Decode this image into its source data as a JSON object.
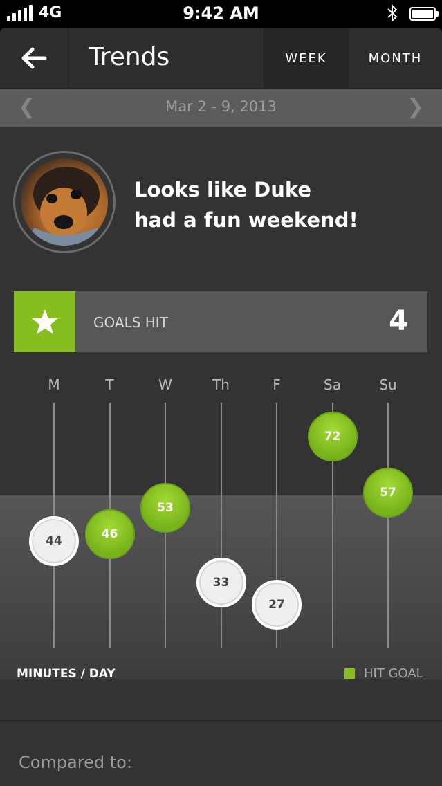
{
  "status_bar": {
    "carrier": "4G",
    "time": "9:42 AM"
  },
  "nav": {
    "title": "Trends",
    "tabs": [
      "WEEK",
      "MONTH"
    ],
    "selected_tab": "WEEK"
  },
  "date_range": {
    "label": "Mar 2 - 9, 2013",
    "prev": "❮",
    "next": "❯"
  },
  "message": {
    "line1": "Looks like Duke",
    "line2": "had a fun weekend!"
  },
  "goals": {
    "label": "GOALS HIT",
    "count": "4"
  },
  "colors": {
    "hit": "#86bd1f",
    "background": "#333334"
  },
  "chart_data": {
    "type": "scatter",
    "categories": [
      "M",
      "T",
      "W",
      "Th",
      "F",
      "Sa",
      "Su"
    ],
    "values": [
      44,
      46,
      53,
      33,
      27,
      72,
      57
    ],
    "hit_goal": [
      false,
      true,
      true,
      false,
      false,
      true,
      true
    ],
    "goal_value": 50,
    "xlabel": "MINUTES / DAY",
    "legend": "HIT GOAL"
  },
  "footer": {
    "compared_label": "Compared to:"
  }
}
